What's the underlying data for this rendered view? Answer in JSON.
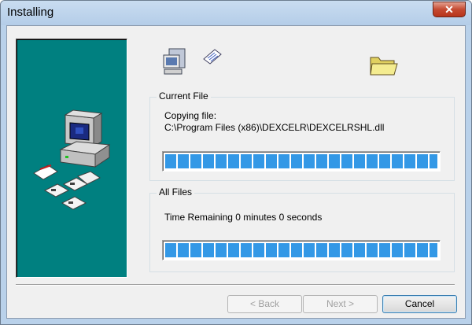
{
  "window": {
    "title": "Installing",
    "close_glyph": "✕"
  },
  "current_file": {
    "group_label": "Current File",
    "status": "Copying file:",
    "path": "C:\\Program Files (x86)\\DEXCELR\\DEXCELRSHL.dll",
    "progress_percent": 100
  },
  "all_files": {
    "group_label": "All Files",
    "time_remaining": "Time Remaining 0 minutes 0 seconds",
    "progress_percent": 100
  },
  "buttons": {
    "back": "< Back",
    "next": "Next >",
    "cancel": "Cancel"
  },
  "icons": {
    "panel": "computer-disks-icon",
    "source": "computer-icon",
    "transfer": "paper-icon",
    "destination": "folder-icon"
  },
  "colors": {
    "panel_bg": "#008080",
    "progress_fill": "#3398e6"
  }
}
